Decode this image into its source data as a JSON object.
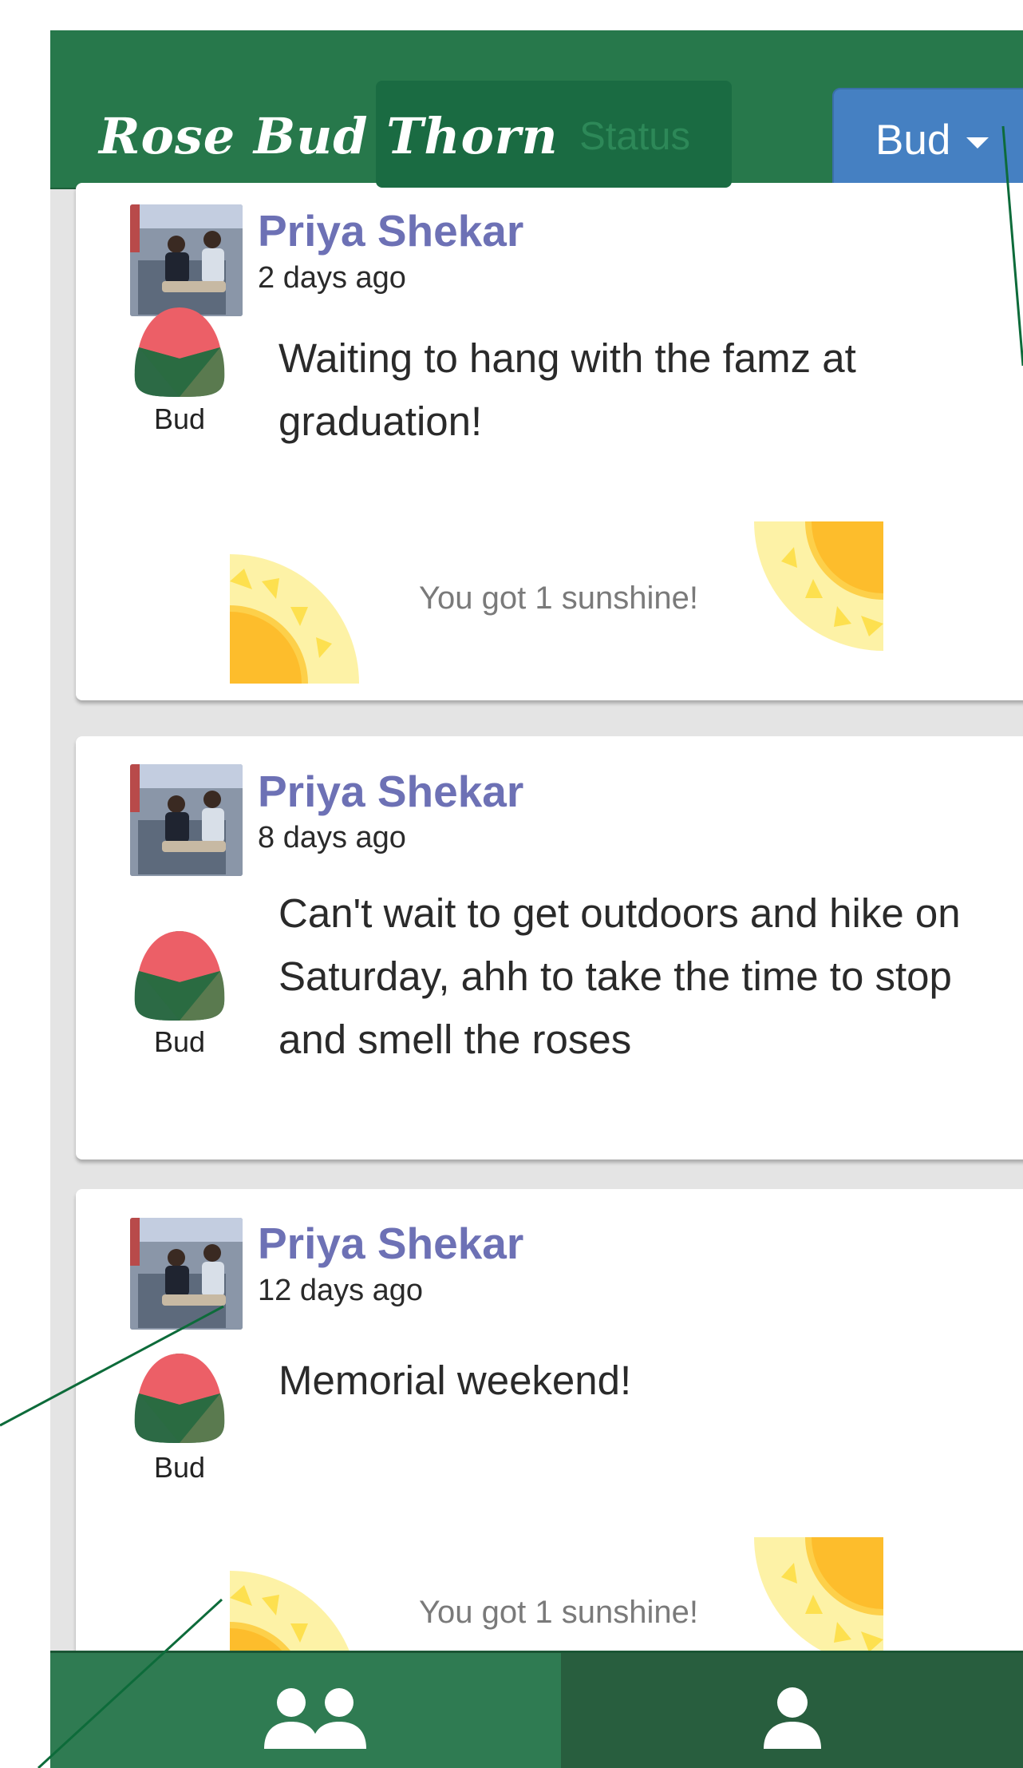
{
  "header": {
    "app_title": "Rose Bud Thorn",
    "update_button_label": "Status",
    "type_dropdown_label": "Bud"
  },
  "posts": [
    {
      "author": "Priya Shekar",
      "time": "2 days ago",
      "type_label": "Bud",
      "text": "Waiting to hang with the famz at graduation!",
      "sunshine": "You got 1 sunshine!"
    },
    {
      "author": "Priya Shekar",
      "time": "8 days ago",
      "type_label": "Bud",
      "text": "Can't wait to get outdoors and hike on Saturday, ahh to take the time to stop and smell the roses"
    },
    {
      "author": "Priya Shekar",
      "time": "12 days ago",
      "type_label": "Bud",
      "text": "Memorial weekend!",
      "sunshine": "You got 1 sunshine!"
    }
  ],
  "bottom_nav": {
    "feed_icon": "group-icon",
    "profile_icon": "person-icon"
  },
  "colors": {
    "header_green": "#27784b",
    "author_purple": "#6d71b5",
    "dropdown_blue": "#4580c2",
    "sun_yellow": "#fdbd2c",
    "callout_green": "#0d6b3a"
  }
}
